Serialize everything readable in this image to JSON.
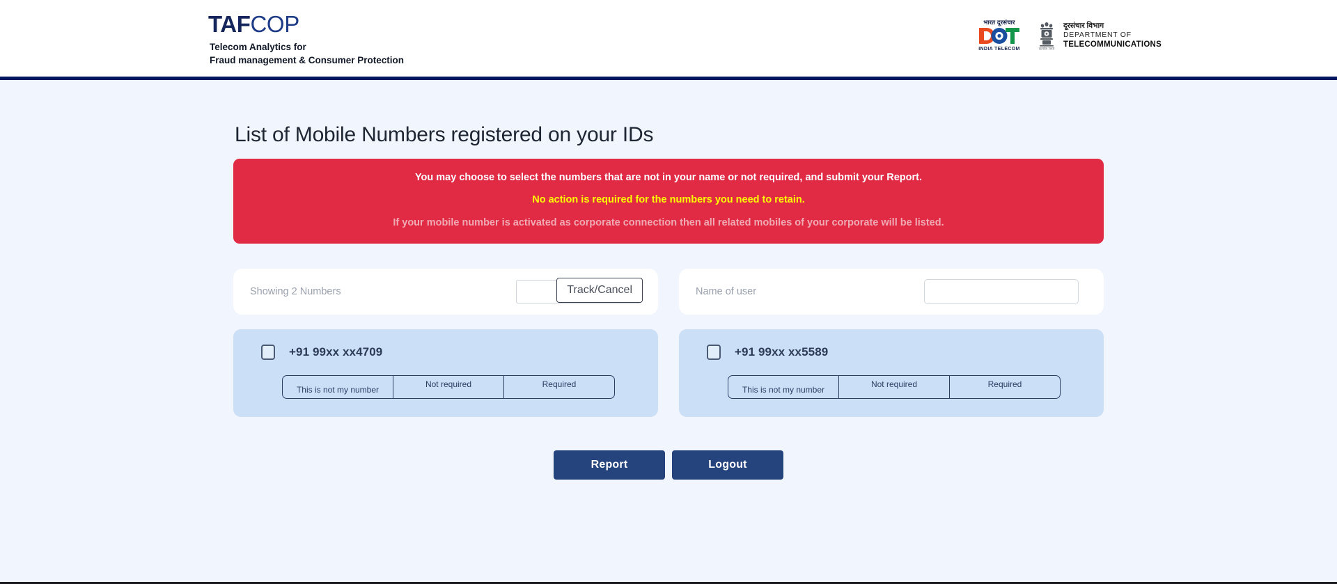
{
  "header": {
    "brand_primary": "TAF",
    "brand_secondary": "COP",
    "brand_tagline_line1": "Telecom Analytics for",
    "brand_tagline_line2": "Fraud management & Consumer Protection",
    "dot_logo": {
      "hindi_top": "भारत दूरसंचार",
      "mark_text": "DOT",
      "sub_text": "INDIA TELECOM",
      "color_d": "#e8491f",
      "color_o": "#1a4fa0",
      "color_t": "#14964a"
    },
    "department": {
      "hindi": "दूरसंचार विभाग",
      "line1": "DEPARTMENT OF",
      "line2": "TELECOMMUNICATIONS",
      "emblem_motto": "सत्यमेव जयते"
    }
  },
  "main": {
    "page_title": "List of Mobile Numbers registered on your IDs",
    "alert": {
      "line1": "You may choose to select the numbers that are not in your name or not required, and submit your Report.",
      "line2": "No action is required for the numbers you need to retain.",
      "line3": "If your mobile number is activated as corporate connection then all related mobiles of your corporate will be listed.",
      "bg_color": "#e12a44",
      "line2_color": "#ffff00",
      "line3_color": "#f0aab3"
    },
    "filters": {
      "showing_label": "Showing 2 Numbers",
      "track_input_value": "",
      "track_input_placeholder": "",
      "track_button_label": "Track/Cancel",
      "name_label": "Name of user",
      "name_input_value": "",
      "name_input_placeholder": ""
    },
    "numbers": [
      {
        "number": "+91 99xx xx4709",
        "checked": false,
        "options": [
          "This is not my number",
          "Not required",
          "Required"
        ]
      },
      {
        "number": "+91 99xx xx5589",
        "checked": false,
        "options": [
          "This is not my number",
          "Not required",
          "Required"
        ]
      }
    ],
    "actions": {
      "report_label": "Report",
      "logout_label": "Logout",
      "button_color": "#25437c"
    }
  }
}
